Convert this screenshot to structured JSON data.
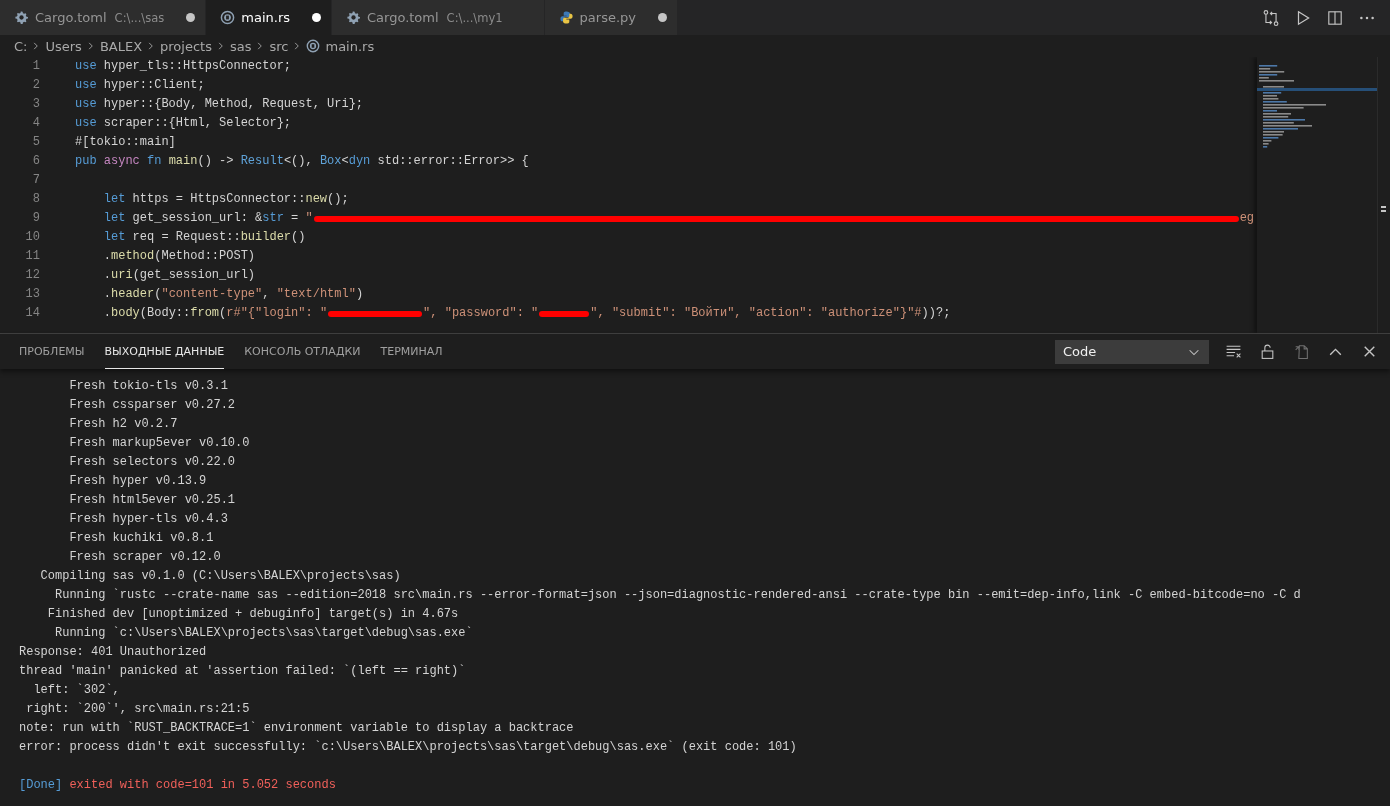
{
  "tabs": [
    {
      "label": "Cargo.toml",
      "description": "C:\\...\\sas",
      "kind": "settings",
      "selected": false,
      "modified": true
    },
    {
      "label": "main.rs",
      "kind": "rust",
      "selected": true,
      "modified": true
    },
    {
      "label": "Cargo.toml",
      "description": "C:\\...\\my1",
      "kind": "settings",
      "selected": false,
      "modified": false
    },
    {
      "label": "parse.py",
      "kind": "python",
      "selected": false,
      "modified": true
    }
  ],
  "breadcrumbs": [
    {
      "text": "C:",
      "kind": "folder"
    },
    {
      "text": "Users",
      "kind": "folder"
    },
    {
      "text": "BALEX",
      "kind": "folder"
    },
    {
      "text": "projects",
      "kind": "folder"
    },
    {
      "text": "sas",
      "kind": "folder"
    },
    {
      "text": "src",
      "kind": "folder"
    },
    {
      "text": "main.rs",
      "kind": "rust"
    }
  ],
  "editor": {
    "lines": [
      {
        "number": "1",
        "tokens": [
          {
            "kind": "kw",
            "text": "use"
          },
          {
            "kind": "txt",
            "text": " hyper_tls::HttpsConnector;"
          }
        ]
      },
      {
        "number": "2",
        "tokens": [
          {
            "kind": "kw",
            "text": "use"
          },
          {
            "kind": "txt",
            "text": " hyper::Client;"
          }
        ]
      },
      {
        "number": "3",
        "tokens": [
          {
            "kind": "kw",
            "text": "use"
          },
          {
            "kind": "txt",
            "text": " hyper::{Body, Method, Request, Uri};"
          }
        ]
      },
      {
        "number": "4",
        "tokens": [
          {
            "kind": "kw",
            "text": "use"
          },
          {
            "kind": "txt",
            "text": " scraper::{Html, Selector};"
          }
        ]
      },
      {
        "number": "5",
        "tokens": [
          {
            "kind": "txt",
            "text": "#[tokio::main]"
          }
        ]
      },
      {
        "number": "6",
        "tokens": [
          {
            "kind": "kw",
            "text": "pub"
          },
          {
            "kind": "ctrl",
            "text": " async"
          },
          {
            "kind": "kw",
            "text": " fn"
          },
          {
            "kind": "fn",
            "text": " main"
          },
          {
            "kind": "txt",
            "text": "() -> "
          },
          {
            "kind": "type",
            "text": "Result"
          },
          {
            "kind": "txt",
            "text": "<(), "
          },
          {
            "kind": "type",
            "text": "Box"
          },
          {
            "kind": "txt",
            "text": "<"
          },
          {
            "kind": "kw",
            "text": "dyn"
          },
          {
            "kind": "txt",
            "text": " std::error::Error>> {"
          }
        ]
      },
      {
        "number": "7"
      },
      {
        "number": "8",
        "tokens": [
          {
            "kind": "kw",
            "text": "    let"
          },
          {
            "kind": "txt",
            "text": " https = HttpsConnector::"
          },
          {
            "kind": "fn",
            "text": "new"
          },
          {
            "kind": "txt",
            "text": "();"
          }
        ]
      },
      {
        "number": "9",
        "tokens": [
          {
            "kind": "kw",
            "text": "    let"
          },
          {
            "kind": "txt",
            "text": " get_session_url: &"
          },
          {
            "kind": "kw",
            "text": "str"
          },
          {
            "kind": "txt",
            "text": " = "
          },
          {
            "kind": "str",
            "text": "\""
          },
          {
            "kind": "redact"
          },
          {
            "kind": "str",
            "text": "eg"
          }
        ]
      },
      {
        "number": "10",
        "tokens": [
          {
            "kind": "kw",
            "text": "    let"
          },
          {
            "kind": "txt",
            "text": " req = Request::"
          },
          {
            "kind": "fn",
            "text": "builder"
          },
          {
            "kind": "txt",
            "text": "()"
          }
        ]
      },
      {
        "number": "11",
        "tokens": [
          {
            "kind": "txt",
            "text": "    ."
          },
          {
            "kind": "fn",
            "text": "method"
          },
          {
            "kind": "txt",
            "text": "(Method::POST)"
          }
        ]
      },
      {
        "number": "12",
        "tokens": [
          {
            "kind": "txt",
            "text": "    ."
          },
          {
            "kind": "fn",
            "text": "uri"
          },
          {
            "kind": "txt",
            "text": "(get_session_url)"
          }
        ]
      },
      {
        "number": "13",
        "tokens": [
          {
            "kind": "txt",
            "text": "    ."
          },
          {
            "kind": "fn",
            "text": "header"
          },
          {
            "kind": "txt",
            "text": "("
          },
          {
            "kind": "str",
            "text": "\"content-type\""
          },
          {
            "kind": "txt",
            "text": ", "
          },
          {
            "kind": "str",
            "text": "\"text/html\""
          },
          {
            "kind": "txt",
            "text": ")"
          }
        ]
      },
      {
        "number": "14",
        "tokens": [
          {
            "kind": "txt",
            "text": "    ."
          },
          {
            "kind": "fn",
            "text": "body"
          },
          {
            "kind": "txt",
            "text": "(Body::"
          },
          {
            "kind": "fn",
            "text": "from"
          },
          {
            "kind": "txt",
            "text": "("
          },
          {
            "kind": "str",
            "text": "r#\"{\"login\": \""
          },
          {
            "kind": "redact"
          },
          {
            "kind": "str",
            "text": "\", \"password\": \""
          },
          {
            "kind": "redact"
          },
          {
            "kind": "str",
            "text": "\", \"submit\": \"Войти\", \"action\": \"authorize\"}\"#"
          },
          {
            "kind": "txt",
            "text": "))?;"
          }
        ]
      }
    ]
  },
  "panel": {
    "tabs": [
      {
        "label": "ПРОБЛЕМЫ",
        "selected": false
      },
      {
        "label": "ВЫХОДНЫЕ ДАННЫЕ",
        "selected": true
      },
      {
        "label": "КОНСОЛЬ ОТЛАДКИ",
        "selected": false
      },
      {
        "label": "ТЕРМИНАЛ",
        "selected": false
      }
    ],
    "channel": {
      "value": "Code"
    },
    "output": [
      {
        "text": "       Fresh tokio-tls v0.3.1"
      },
      {
        "text": "       Fresh cssparser v0.27.2"
      },
      {
        "text": "       Fresh h2 v0.2.7"
      },
      {
        "text": "       Fresh markup5ever v0.10.0"
      },
      {
        "text": "       Fresh selectors v0.22.0"
      },
      {
        "text": "       Fresh hyper v0.13.9"
      },
      {
        "text": "       Fresh html5ever v0.25.1"
      },
      {
        "text": "       Fresh hyper-tls v0.4.3"
      },
      {
        "text": "       Fresh kuchiki v0.8.1"
      },
      {
        "text": "       Fresh scraper v0.12.0"
      },
      {
        "text": "   Compiling sas v0.1.0 (C:\\Users\\BALEX\\projects\\sas)"
      },
      {
        "text": "     Running `rustc --crate-name sas --edition=2018 src\\main.rs --error-format=json --json=diagnostic-rendered-ansi --crate-type bin --emit=dep-info,link -C embed-bitcode=no -C d"
      },
      {
        "text": "    Finished dev [unoptimized + debuginfo] target(s) in 4.67s"
      },
      {
        "text": "     Running `c:\\Users\\BALEX\\projects\\sas\\target\\debug\\sas.exe`"
      },
      {
        "text": "Response: 401 Unauthorized"
      },
      {
        "text": "thread 'main' panicked at 'assertion failed: `(left == right)`"
      },
      {
        "text": "  left: `302`,"
      },
      {
        "text": " right: `200`', src\\main.rs:21:5"
      },
      {
        "text": "note: run with `RUST_BACKTRACE=1` environment variable to display a backtrace"
      },
      {
        "text": "error: process didn't exit successfully: `c:\\Users\\BALEX\\projects\\sas\\target\\debug\\sas.exe` (exit code: 101)"
      },
      {
        "kind": "done",
        "tokens": [
          {
            "kind": "info",
            "text": "[Done]"
          },
          {
            "kind": "error",
            "text": " exited with code=101 in 5.052 seconds"
          }
        ]
      }
    ]
  }
}
